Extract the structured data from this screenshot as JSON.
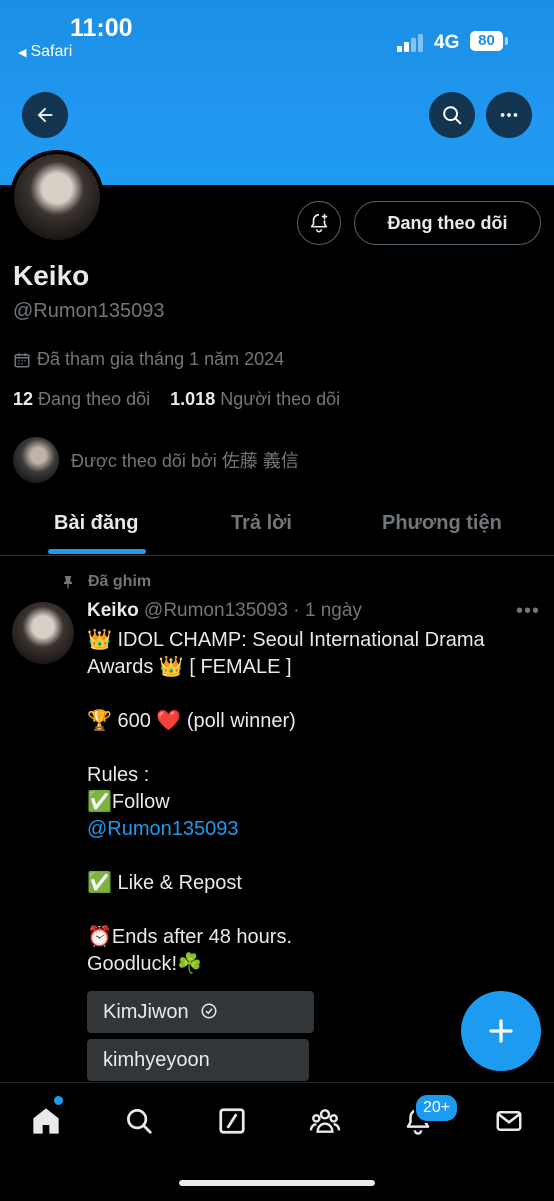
{
  "status_bar": {
    "time": "11:00",
    "back_app": "Safari",
    "network": "4G",
    "battery": "80"
  },
  "header": {
    "back_icon": "arrow-left-icon",
    "search_icon": "search-icon",
    "more_icon": "more-horizontal-icon"
  },
  "profile": {
    "name": "Keiko",
    "handle": "@Rumon135093",
    "joined": "Đã tham gia tháng 1 năm 2024",
    "following_count": "12",
    "following_label": "Đang theo dõi",
    "followers_count": "1.018",
    "followers_label": "Người theo dõi",
    "followed_by": "Được theo dõi bởi 佐藤 義信",
    "follow_button": "Đang theo dõi"
  },
  "tabs": [
    "Bài đăng",
    "Trả lời",
    "Phương tiện"
  ],
  "post": {
    "pinned_label": "Đã ghim",
    "author": "Keiko",
    "meta": "@Rumon135093 · 1 ngày",
    "line1": "👑 IDOL CHAMP: Seoul International Drama",
    "line2": "Awards 👑 [ FEMALE ]",
    "line3": "🏆 600 ❤️ (poll winner)",
    "line4": "Rules :",
    "line5": "✅Follow",
    "mention": "@Rumon135093",
    "line6": "✅ Like & Repost",
    "line7": "⏰Ends after 48 hours.",
    "line8": "Goodluck!☘️",
    "poll_options": [
      "KimJiwon",
      "kimhyeyoon"
    ]
  },
  "nav": {
    "notifications_badge": "20+"
  },
  "colors": {
    "accent": "#1d9bf0",
    "background": "#000000",
    "muted": "#71767b"
  }
}
